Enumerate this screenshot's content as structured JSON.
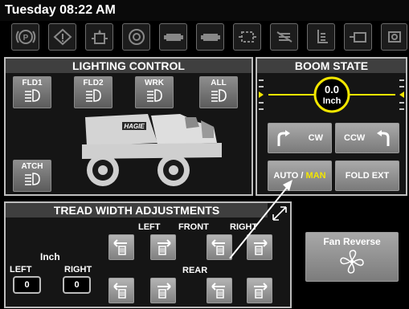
{
  "header": {
    "datetime": "Tuesday 08:22 AM"
  },
  "warning_icons": [
    "parking-brake-icon",
    "warning-triangle-icon",
    "hydraulic-fluid-icon",
    "engine-fan-icon",
    "battery-icon",
    "battery-icon",
    "engine-coolant-icon",
    "engine-filter-icon",
    "fuel-level-icon",
    "engine-oil-icon",
    "engine-temp-icon"
  ],
  "lighting": {
    "title": "LIGHTING CONTROL",
    "buttons": {
      "fld1": "FLD1",
      "fld2": "FLD2",
      "wrk": "WRK",
      "all": "ALL",
      "atch": "ATCH"
    },
    "brand": "HAGIE"
  },
  "boom": {
    "title": "BOOM STATE",
    "value": "0.0",
    "unit": "Inch",
    "cw_label": "CW",
    "ccw_label": "CCW",
    "auto_label": "AUTO",
    "slash": " / ",
    "man_label": "MAN",
    "fold_ext_label": "FOLD EXT"
  },
  "tread": {
    "title": "TREAD WIDTH ADJUSTMENTS",
    "left_label": "LEFT",
    "front_label": "FRONT",
    "right_label": "RIGHT",
    "rear_label": "REAR",
    "unit_label": "Inch",
    "left_value_label": "LEFT",
    "right_value_label": "RIGHT",
    "left_value": "0",
    "right_value": "0"
  },
  "fan": {
    "label": "Fan Reverse"
  },
  "colors": {
    "accent_yellow": "#f2e600",
    "panel_border": "#bdbdbd",
    "title_bar": "#3f3f3f"
  }
}
